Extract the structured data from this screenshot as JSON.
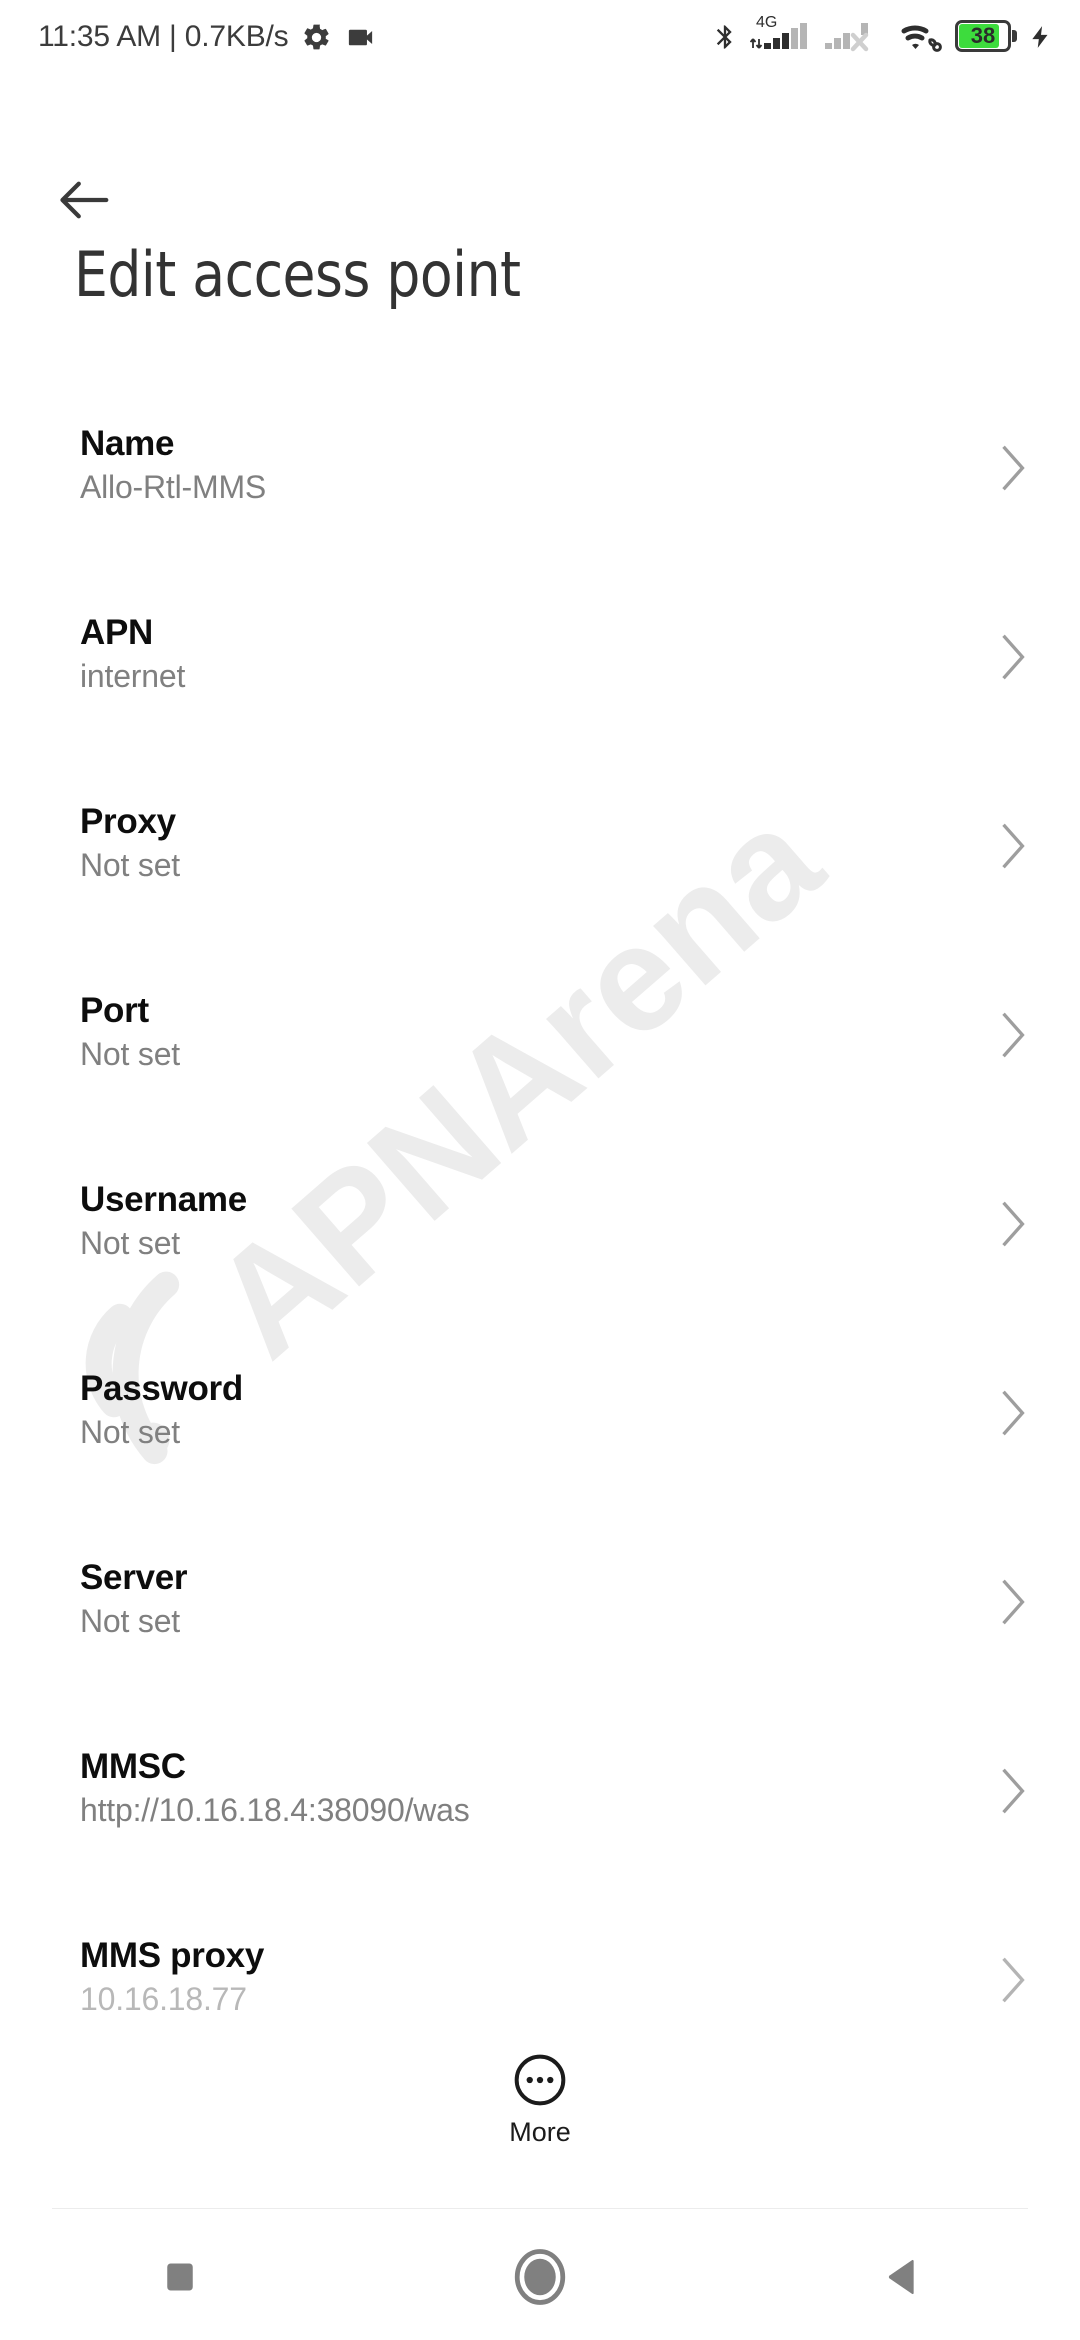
{
  "status_bar": {
    "clock": "11:35 AM | 0.7KB/s",
    "left_icons": [
      "gear-icon",
      "camcorder-icon"
    ],
    "right_icons": [
      "bluetooth-icon",
      "signal-4g-icon",
      "signal-no-service-icon",
      "wifi-icon",
      "battery-icon",
      "charging-bolt-icon"
    ],
    "network_label": "4G",
    "battery_percent": "38",
    "battery_color": "#3ddc3d",
    "icon_color": "#3c3c3c"
  },
  "header": {
    "back_label": "Back",
    "title": "Edit access point"
  },
  "watermark": {
    "text": "APNArena",
    "color": "#ececec"
  },
  "list": {
    "chevron": "›",
    "items": [
      {
        "label": "Name",
        "value": "Allo-Rtl-MMS"
      },
      {
        "label": "APN",
        "value": "internet"
      },
      {
        "label": "Proxy",
        "value": "Not set"
      },
      {
        "label": "Port",
        "value": "Not set"
      },
      {
        "label": "Username",
        "value": "Not set"
      },
      {
        "label": "Password",
        "value": "Not set"
      },
      {
        "label": "Server",
        "value": "Not set"
      },
      {
        "label": "MMSC",
        "value": "http://10.16.18.4:38090/was"
      },
      {
        "label": "MMS proxy",
        "value": "10.16.18.77"
      }
    ]
  },
  "more_button": {
    "label": "More",
    "icon": "more-circle-icon"
  },
  "navigation_bar": {
    "recents_label": "Recents",
    "home_label": "Home",
    "back_label": "Back",
    "color": "#808080"
  }
}
